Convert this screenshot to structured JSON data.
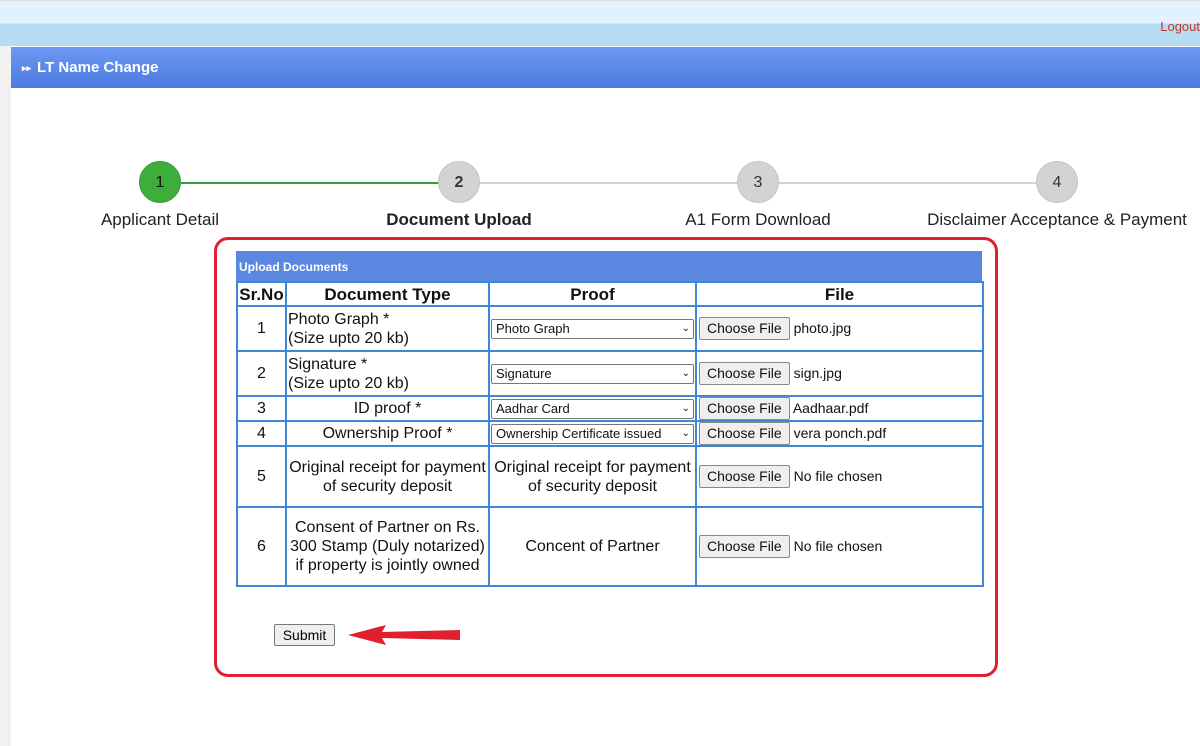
{
  "header": {
    "logout": "Logout",
    "title": "LT Name Change",
    "title_icon": "double-chevron-right-icon"
  },
  "stepper": {
    "steps": [
      {
        "number": "1",
        "label": "Applicant Detail",
        "state": "completed"
      },
      {
        "number": "2",
        "label": "Document Upload",
        "state": "active"
      },
      {
        "number": "3",
        "label": "A1 Form Download",
        "state": "pending"
      },
      {
        "number": "4",
        "label": "Disclaimer Acceptance & Payment",
        "state": "pending"
      }
    ],
    "colors": {
      "completed": "#3dae3a",
      "pending": "#d3d3d3"
    }
  },
  "upload": {
    "title": "Upload Documents",
    "columns": [
      "Sr.No",
      "Document Type",
      "Proof",
      "File"
    ],
    "choose_label": "Choose File",
    "rows": [
      {
        "sr": "1",
        "type": "Photo Graph *\n(Size upto 20 kb)",
        "proof": "Photo Graph",
        "proof_is_select": true,
        "file": "photo.jpg"
      },
      {
        "sr": "2",
        "type": "Signature *\n(Size upto 20 kb)",
        "proof": "Signature",
        "proof_is_select": true,
        "file": "sign.jpg"
      },
      {
        "sr": "3",
        "type": "ID proof *",
        "proof": "Aadhar Card",
        "proof_is_select": true,
        "file": "Aadhaar.pdf"
      },
      {
        "sr": "4",
        "type": "Ownership Proof *",
        "proof": "Ownership Certificate issued",
        "proof_is_select": true,
        "file": "vera ponch.pdf"
      },
      {
        "sr": "5",
        "type": "Original receipt for payment of security deposit",
        "proof": "Original receipt for payment of security deposit",
        "proof_is_select": false,
        "file": "No file chosen"
      },
      {
        "sr": "6",
        "type": "Consent of Partner on Rs. 300 Stamp (Duly notarized) if property is jointly owned",
        "proof": "Concent of Partner",
        "proof_is_select": false,
        "file": "No file chosen"
      }
    ]
  },
  "submit_label": "Submit",
  "highlight_color": "#e0202e"
}
